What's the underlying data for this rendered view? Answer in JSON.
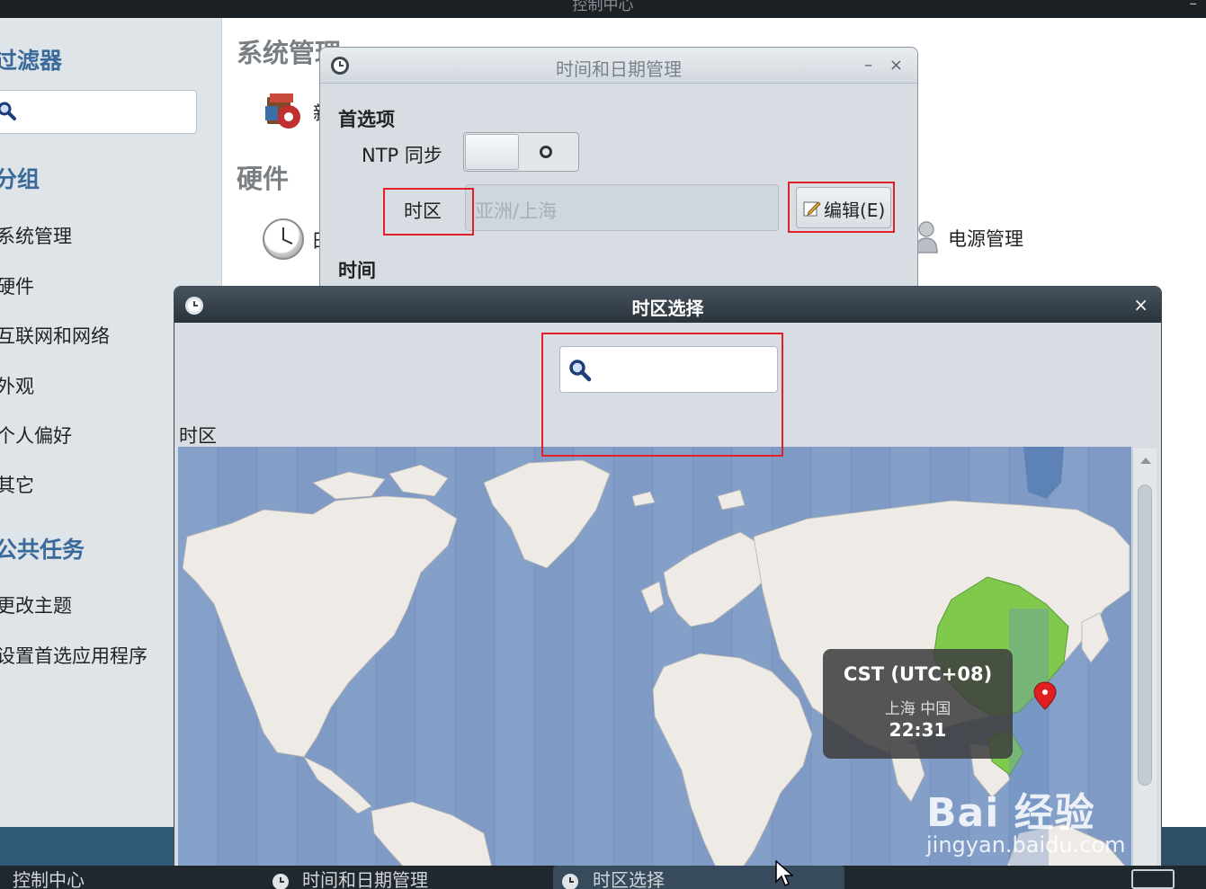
{
  "window": {
    "title": "控制中心"
  },
  "sidebar": {
    "filter_heading": "过滤器",
    "groups_heading": "分组",
    "groups": [
      "系统管理",
      "硬件",
      "互联网和网络",
      "外观",
      "个人偏好",
      "其它"
    ],
    "tasks_heading": "公共任务",
    "tasks": [
      "更改主题",
      "设置首选应用程序"
    ]
  },
  "main": {
    "sections": [
      "系统管理",
      "硬件"
    ],
    "partial_item": "新",
    "partial_item_2": "日",
    "power_label": "电源管理"
  },
  "date_time_dialog": {
    "title": "时间和日期管理",
    "preferences_heading": "首选项",
    "ntp_label": "NTP 同步",
    "ntp_enabled": false,
    "timezone_label": "时区",
    "timezone_value": "亚洲/上海",
    "edit_button": "编辑(E)",
    "time_heading": "时间",
    "minimize": "–",
    "close": "×"
  },
  "tz_dialog": {
    "title": "时区选择",
    "close": "×",
    "search_placeholder": "",
    "timezone_label": "时区",
    "tooltip": {
      "zone": "CST (UTC+08)",
      "location": "上海 中国",
      "time": "22:31"
    },
    "highlight_color": "#7fc94d",
    "marker_color": "#e02020"
  },
  "taskbar": {
    "items": [
      "控制中心",
      "时间和日期管理",
      "时区选择"
    ],
    "active": "时区选择"
  },
  "watermark": {
    "brand": "Bai 经验",
    "url": "jingyan.baidu.com"
  },
  "colors": {
    "accent": "#3a6a9a",
    "annotation": "#e0202a",
    "ocean": "#7f9bc5",
    "land": "#eeeae6"
  }
}
